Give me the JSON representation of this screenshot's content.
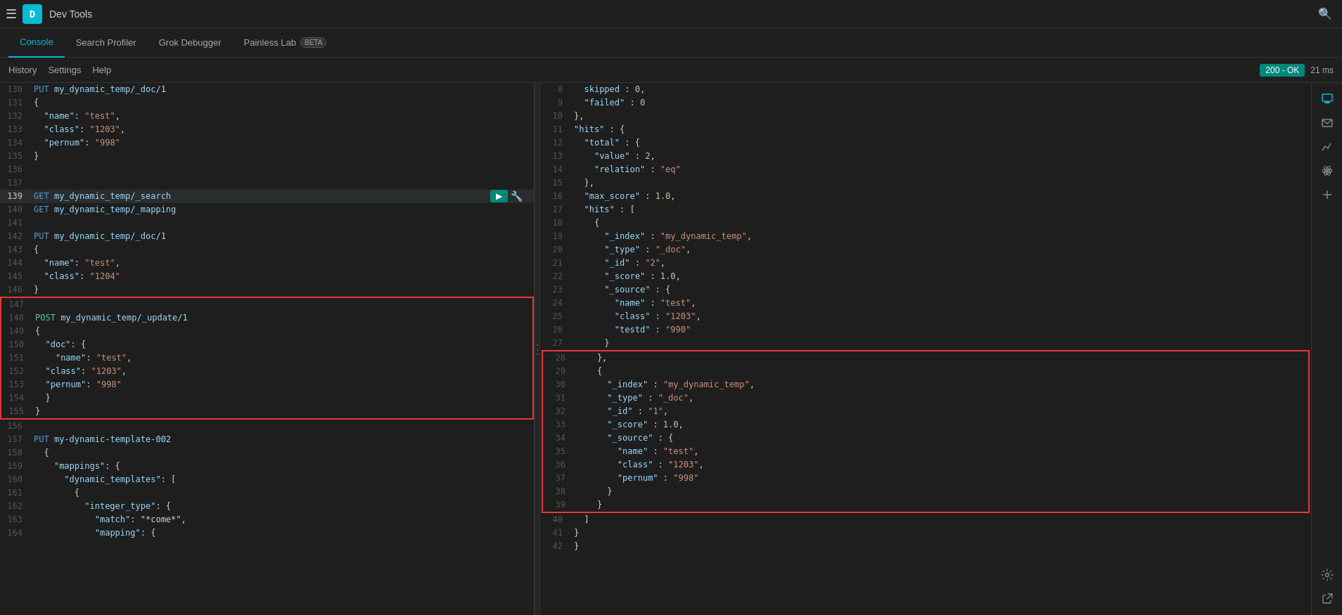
{
  "app": {
    "icon_letter": "D",
    "title": "Dev Tools"
  },
  "tabs": [
    {
      "id": "console",
      "label": "Console",
      "active": true,
      "badge": null
    },
    {
      "id": "search-profiler",
      "label": "Search Profiler",
      "active": false,
      "badge": null
    },
    {
      "id": "grok-debugger",
      "label": "Grok Debugger",
      "active": false,
      "badge": null
    },
    {
      "id": "painless-lab",
      "label": "Painless Lab",
      "active": false,
      "badge": "BETA"
    }
  ],
  "actions": {
    "history": "History",
    "settings": "Settings",
    "help": "Help"
  },
  "status": {
    "code": "200 - OK",
    "time": "21 ms"
  },
  "editor": {
    "lines": [
      {
        "num": "130",
        "content": "PUT my_dynamic_temp/_doc/1",
        "type": "request"
      },
      {
        "num": "131",
        "content": "{",
        "type": "code"
      },
      {
        "num": "132",
        "content": "  \"name\":\"test\",",
        "type": "code"
      },
      {
        "num": "133",
        "content": "  \"class\":\"1203\",",
        "type": "code"
      },
      {
        "num": "134",
        "content": "  \"pernum\":\"998\"",
        "type": "code"
      },
      {
        "num": "135",
        "content": "}",
        "type": "code"
      },
      {
        "num": "136",
        "content": "",
        "type": "code"
      },
      {
        "num": "137",
        "content": "",
        "type": "code"
      },
      {
        "num": "139",
        "content": "GET my_dynamic_temp/_search",
        "type": "request",
        "active": true
      },
      {
        "num": "140",
        "content": "GET my_dynamic_temp/_mapping",
        "type": "request"
      },
      {
        "num": "141",
        "content": "",
        "type": "code"
      },
      {
        "num": "142",
        "content": "PUT my_dynamic_temp/_doc/1",
        "type": "request"
      },
      {
        "num": "143",
        "content": "{",
        "type": "code"
      },
      {
        "num": "144",
        "content": "  \"name\":\"test\",",
        "type": "code"
      },
      {
        "num": "145",
        "content": "  \"class\":\"1204\"",
        "type": "code"
      },
      {
        "num": "146",
        "content": "}",
        "type": "code"
      },
      {
        "num": "147",
        "content": "",
        "type": "code",
        "red_start": true
      },
      {
        "num": "148",
        "content": "POST my_dynamic_temp/_update/1",
        "type": "request"
      },
      {
        "num": "149",
        "content": "{",
        "type": "code"
      },
      {
        "num": "150",
        "content": "  \"doc\": {",
        "type": "code"
      },
      {
        "num": "151",
        "content": "    \"name\":\"test\",",
        "type": "code"
      },
      {
        "num": "152",
        "content": "  \"class\":\"1203\",",
        "type": "code"
      },
      {
        "num": "153",
        "content": "  \"pernum\":\"998\"",
        "type": "code"
      },
      {
        "num": "154",
        "content": "  }",
        "type": "code"
      },
      {
        "num": "155",
        "content": "}",
        "type": "code",
        "red_end": true
      },
      {
        "num": "156",
        "content": "",
        "type": "code"
      },
      {
        "num": "157",
        "content": "PUT my-dynamic-template-002",
        "type": "request"
      },
      {
        "num": "158",
        "content": "  {",
        "type": "code"
      },
      {
        "num": "159",
        "content": "    \"mappings\": {",
        "type": "code"
      },
      {
        "num": "160",
        "content": "      \"dynamic_templates\": [",
        "type": "code"
      },
      {
        "num": "161",
        "content": "        {",
        "type": "code"
      },
      {
        "num": "162",
        "content": "          \"integer_type\": {",
        "type": "code"
      },
      {
        "num": "163",
        "content": "            \"match\": \"*come*\",",
        "type": "code"
      },
      {
        "num": "164",
        "content": "            \"mapping\": {",
        "type": "code"
      }
    ]
  },
  "output": {
    "lines": [
      {
        "num": "8",
        "content": "  skipped : 0,"
      },
      {
        "num": "9",
        "content": "  \"failed\" : 0"
      },
      {
        "num": "10",
        "content": "},"
      },
      {
        "num": "11",
        "content": "\"hits\" : {"
      },
      {
        "num": "12",
        "content": "  \"total\" : {"
      },
      {
        "num": "13",
        "content": "    \"value\" : 2,"
      },
      {
        "num": "14",
        "content": "    \"relation\" : \"eq\""
      },
      {
        "num": "15",
        "content": "  },"
      },
      {
        "num": "16",
        "content": "  \"max_score\" : 1.0,"
      },
      {
        "num": "17",
        "content": "  \"hits\" : ["
      },
      {
        "num": "18",
        "content": "    {"
      },
      {
        "num": "19",
        "content": "      \"_index\" : \"my_dynamic_temp\","
      },
      {
        "num": "20",
        "content": "      \"_type\" : \"_doc\","
      },
      {
        "num": "21",
        "content": "      \"_id\" : \"2\","
      },
      {
        "num": "22",
        "content": "      \"_score\" : 1.0,"
      },
      {
        "num": "23",
        "content": "      \"_source\" : {"
      },
      {
        "num": "24",
        "content": "        \"name\" : \"test\","
      },
      {
        "num": "25",
        "content": "        \"class\" : \"1203\","
      },
      {
        "num": "26",
        "content": "        \"testd\" : \"990\""
      },
      {
        "num": "27",
        "content": "      }"
      },
      {
        "num": "28",
        "content": "    },",
        "red_start": true
      },
      {
        "num": "29",
        "content": "    {"
      },
      {
        "num": "30",
        "content": "      \"_index\" : \"my_dynamic_temp\","
      },
      {
        "num": "31",
        "content": "      \"_type\" : \"_doc\","
      },
      {
        "num": "32",
        "content": "      \"_id\" : \"1\","
      },
      {
        "num": "33",
        "content": "      \"_score\" : 1.0,"
      },
      {
        "num": "34",
        "content": "      \"_source\" : {"
      },
      {
        "num": "35",
        "content": "        \"name\" : \"test\","
      },
      {
        "num": "36",
        "content": "        \"class\" : \"1203\","
      },
      {
        "num": "37",
        "content": "        \"pernum\" : \"998\""
      },
      {
        "num": "38",
        "content": "      }"
      },
      {
        "num": "39",
        "content": "    }",
        "red_end": true
      },
      {
        "num": "40",
        "content": "  ]"
      },
      {
        "num": "41",
        "content": "}"
      },
      {
        "num": "42",
        "content": "}"
      }
    ]
  },
  "sidebar_icons": [
    {
      "id": "search-icon",
      "symbol": "🔍"
    },
    {
      "id": "tools-icon",
      "symbol": "🔧"
    },
    {
      "id": "monitor-icon",
      "symbol": "📊"
    },
    {
      "id": "extension-icon",
      "symbol": "🧩"
    },
    {
      "id": "globe-icon",
      "symbol": "🌐"
    },
    {
      "id": "flask-icon",
      "symbol": "🧪"
    }
  ]
}
